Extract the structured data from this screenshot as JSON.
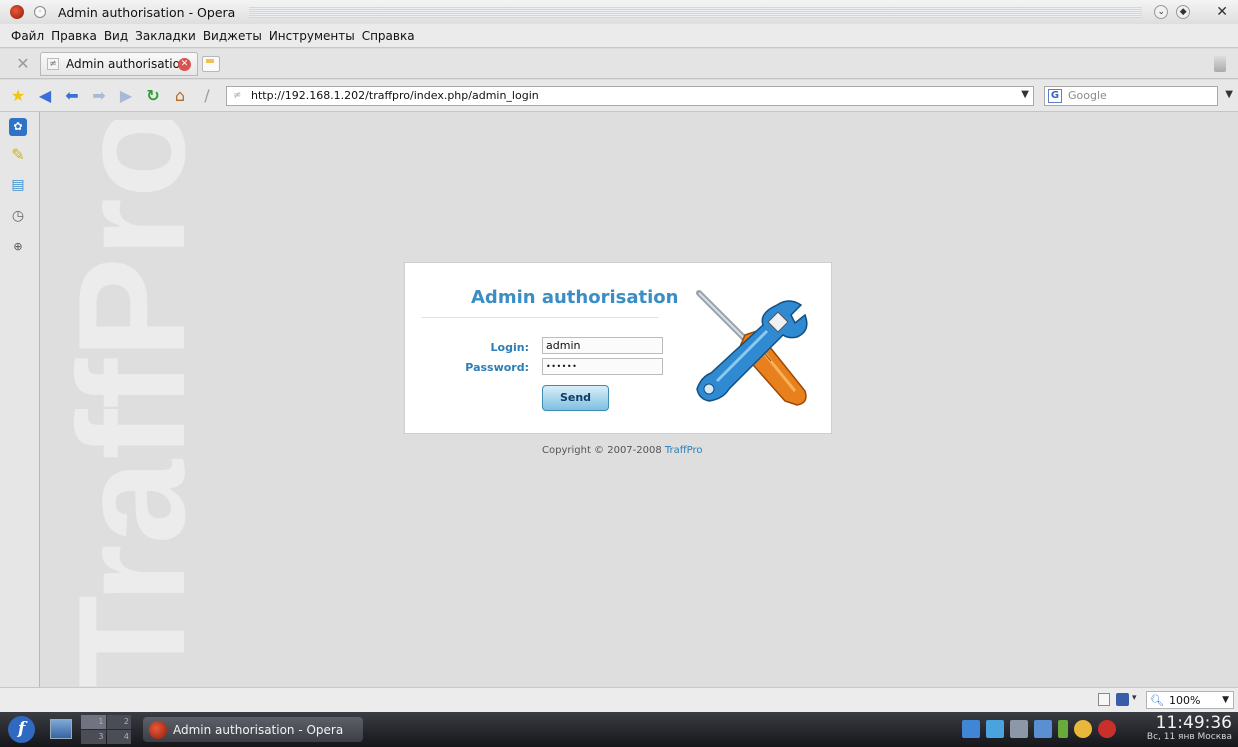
{
  "window": {
    "title": "Admin authorisation - Opera"
  },
  "menu": [
    "Файл",
    "Правка",
    "Вид",
    "Закладки",
    "Виджеты",
    "Инструменты",
    "Справка"
  ],
  "tabs": [
    {
      "label": "Admin authorisation"
    }
  ],
  "address": {
    "url": "http://192.168.1.202/traffpro/index.php/admin_login",
    "search_placeholder": "Google"
  },
  "login_form": {
    "title": "Admin authorisation",
    "login_label": "Login:",
    "login_value": "admin",
    "password_label": "Password:",
    "password_value": "••••••",
    "submit_label": "Send"
  },
  "footer": {
    "copyright_prefix": "Copyright © 2007-2008 ",
    "brand": "TraffPro"
  },
  "watermark_text": "TraffPro",
  "statusbar": {
    "zoom": "100%"
  },
  "taskbar": {
    "pager": [
      "1",
      "2",
      "3",
      "4"
    ],
    "task_label": "Admin authorisation - Opera",
    "time": "11:49:36",
    "date": "Вс, 11 янв Москва"
  },
  "colors": {
    "accent": "#3a8ec5",
    "label": "#2d7db8",
    "send_button": "#7fc0e2",
    "tool_handle": "#e8801e",
    "tool_blue": "#2f8ad1"
  }
}
